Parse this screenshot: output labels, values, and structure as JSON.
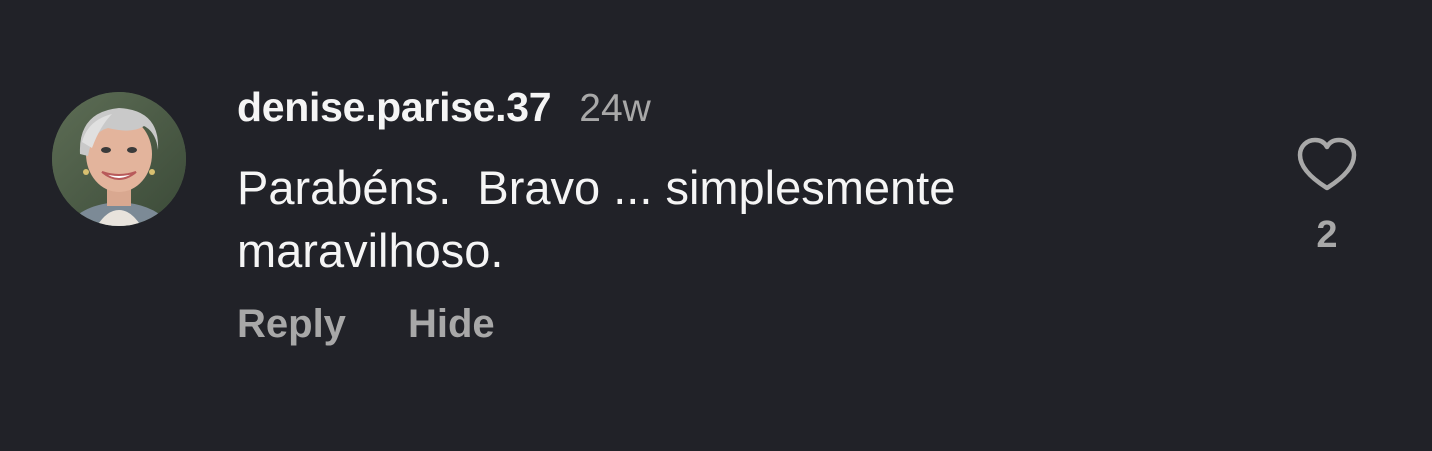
{
  "comment": {
    "username": "denise.parise.37",
    "timestamp": "24w",
    "text": "Parabéns.  Bravo ... simplesmente\nmaravilhoso.",
    "actions": {
      "reply_label": "Reply",
      "hide_label": "Hide"
    },
    "like": {
      "icon": "heart-outline-icon",
      "count": "2"
    }
  },
  "colors": {
    "background": "#212228",
    "primary_text": "#f5f5f5",
    "secondary_text": "#a8a8a8"
  }
}
